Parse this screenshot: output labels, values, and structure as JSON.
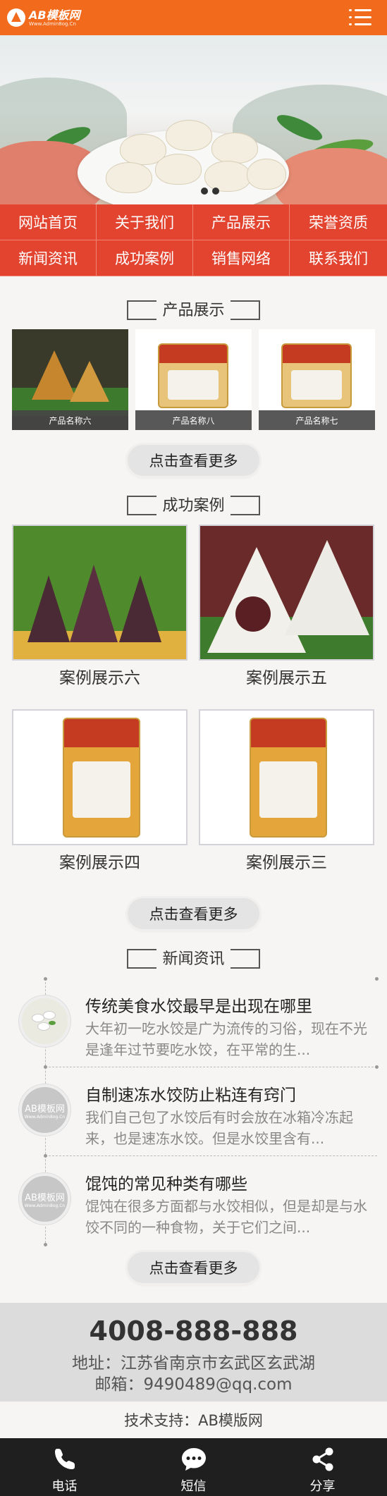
{
  "header": {
    "logo_text": "AB模板网",
    "logo_sub": "Www.Admin8og.Cn"
  },
  "nav": {
    "items": [
      "网站首页",
      "关于我们",
      "产品展示",
      "荣誉资质",
      "新闻资讯",
      "成功案例",
      "销售网络",
      "联系我们"
    ]
  },
  "products": {
    "title": "产品展示",
    "items": [
      {
        "label": "产品名称六"
      },
      {
        "label": "产品名称八"
      },
      {
        "label": "产品名称七"
      }
    ],
    "more": "点击查看更多"
  },
  "cases": {
    "title": "成功案例",
    "items": [
      {
        "label": "案例展示六"
      },
      {
        "label": "案例展示五"
      },
      {
        "label": "案例展示四"
      },
      {
        "label": "案例展示三"
      }
    ],
    "more": "点击查看更多"
  },
  "news": {
    "title": "新闻资讯",
    "items": [
      {
        "title": "传统美食水饺最早是出现在哪里",
        "desc": "大年初一吃水饺是广为流传的习俗，现在不光是逢年过节要吃水饺，在平常的生..."
      },
      {
        "title": "自制速冻水饺防止粘连有窍门",
        "desc": "我们自己包了水饺后有时会放在冰箱冷冻起来，也是速冻水饺。但是水饺里含有...",
        "thumb_text": "AB模板网",
        "thumb_sub": "Www.Admin8og.Cn"
      },
      {
        "title": "馄饨的常见种类有哪些",
        "desc": "馄饨在很多方面都与水饺相似，但是却是与水饺不同的一种食物，关于它们之间...",
        "thumb_text": "AB模板网",
        "thumb_sub": "Www.Admin8og.Cn"
      }
    ],
    "more": "点击查看更多"
  },
  "contact": {
    "phone": "4008-888-888",
    "address": "地址：江苏省南京市玄武区玄武湖",
    "email": "邮箱：9490489@qq.com"
  },
  "support": "技术支持：AB模版网",
  "footer": {
    "call": "电话",
    "sms": "短信",
    "share": "分享"
  },
  "colors": {
    "header": "#f26a1b",
    "nav": "#e2442f",
    "footer": "#1f1f1f"
  }
}
